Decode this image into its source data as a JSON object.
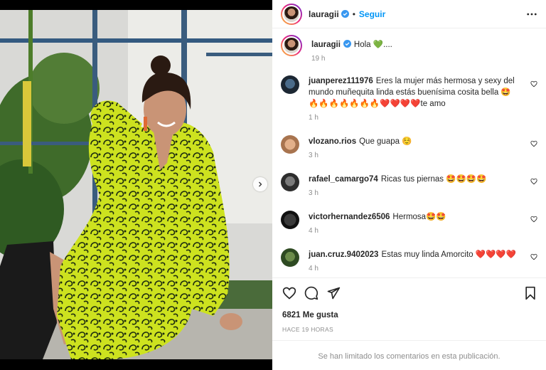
{
  "post": {
    "username": "lauragii",
    "follow_label": "Seguir",
    "separator": "•",
    "caption": "Hola 💚....",
    "caption_time": "19 h"
  },
  "comments": [
    {
      "user": "juanperez111976",
      "text": "Eres la mujer más hermosa y sexy del mundo muñequita linda estás buenísima cosita bella 🤩🔥🔥🔥🔥🔥🔥🔥❤️❤️❤️❤️te amo",
      "time": "1 h"
    },
    {
      "user": "vlozano.rios",
      "text": "Que guapa ☺️",
      "time": "3 h"
    },
    {
      "user": "rafael_camargo74",
      "text": "Ricas tus piernas 🤩🤩🤩🤩",
      "time": "3 h"
    },
    {
      "user": "victorhernandez6506",
      "text": "Hermosa🤩🤩",
      "time": "4 h"
    },
    {
      "user": "juan.cruz.9402023",
      "text": "Estas muy linda Amorcito ❤️❤️❤️❤️",
      "time": "4 h"
    }
  ],
  "stats": {
    "likes": "6821 Me gusta",
    "posted": "HACE 19 HORAS"
  },
  "footer": {
    "limited_notice": "Se han limitado los comentarios en esta publicación."
  },
  "icons": {
    "verified": "verified-badge-icon",
    "more": "more-options-icon",
    "like": "heart-icon",
    "comment": "comment-icon",
    "share": "share-icon",
    "save": "bookmark-icon",
    "carousel": "chevron-right-icon"
  },
  "colors": {
    "accent": "#0095f6",
    "verified": "#3897f0",
    "muted": "#8e8e8e",
    "text": "#262626",
    "dress": "#c8e01e"
  }
}
